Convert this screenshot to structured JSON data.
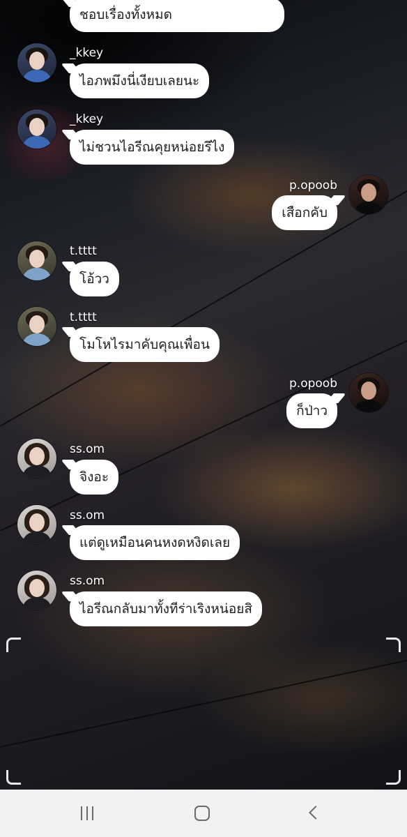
{
  "messages": [
    {
      "side": "left",
      "user": "",
      "avatar": "none",
      "text": "ชอบเรื่องทั้งหมด"
    },
    {
      "side": "left",
      "user": "_kkey",
      "avatar": "kkey-avatar",
      "text": "ไอภพมึงนี่เงียบเลยนะ"
    },
    {
      "side": "left",
      "user": "_kkey",
      "avatar": "kkey-avatar",
      "text": "ไม่ชวนไอรีณคุยหน่อยรึไง"
    },
    {
      "side": "right",
      "user": "p.opoob",
      "avatar": "popoob-avatar",
      "text": "เสือกคับ"
    },
    {
      "side": "left",
      "user": "t.tttt",
      "avatar": "tttt-avatar",
      "text": "โอ้วว"
    },
    {
      "side": "left",
      "user": "t.tttt",
      "avatar": "tttt-avatar",
      "text": "โมโหไรมาคับคุณเพื่อน"
    },
    {
      "side": "right",
      "user": "p.opoob",
      "avatar": "popoob-avatar",
      "text": "ก็ป่าว"
    },
    {
      "side": "left",
      "user": "ss.om",
      "avatar": "ssom-avatar",
      "text": "จิงอะ"
    },
    {
      "side": "left",
      "user": "ss.om",
      "avatar": "ssom-avatar",
      "text": "แต่ดูเหมือนคนหงดหงิดเลย"
    },
    {
      "side": "left",
      "user": "ss.om",
      "avatar": "ssom-avatar",
      "text": "ไอรีณกลับมาทั้งทีร่าเริงหน่อยสิ"
    }
  ],
  "navbar": {
    "buttons": [
      "recents-icon",
      "home-icon",
      "back-icon"
    ],
    "background": "#f2f2f2"
  },
  "colors": {
    "bubble": "#ffffff",
    "bubble_text": "#1e1e1e",
    "username": "#ffffff"
  }
}
